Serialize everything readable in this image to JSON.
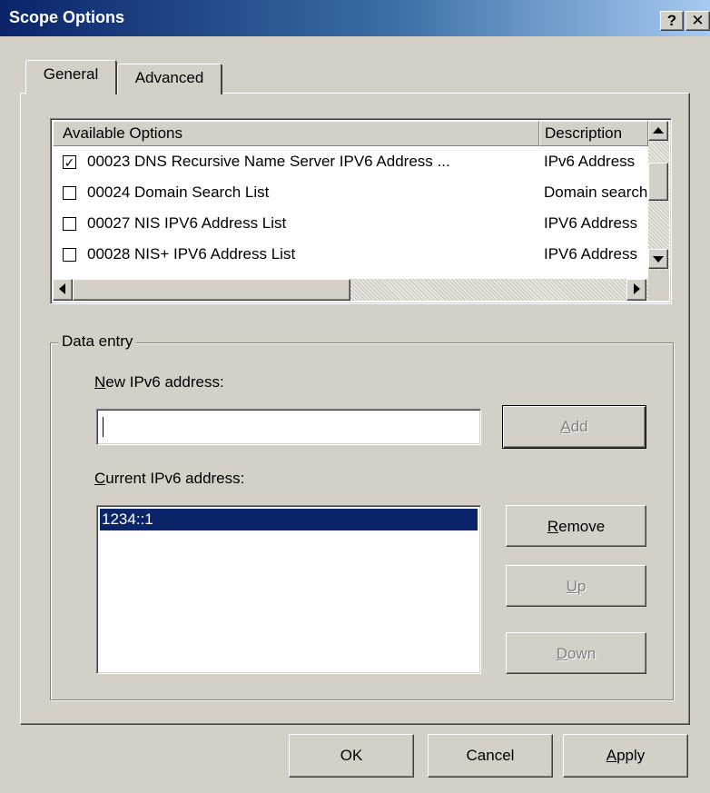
{
  "window": {
    "title": "Scope Options",
    "help_glyph": "?",
    "close_glyph": "✕"
  },
  "tabs": [
    {
      "label": "General",
      "selected": true
    },
    {
      "label": "Advanced",
      "selected": false
    }
  ],
  "options_list": {
    "columns": [
      "Available Options",
      "Description"
    ],
    "rows": [
      {
        "checked": true,
        "name": "00023 DNS Recursive Name Server IPV6 Address ...",
        "description": "IPv6 Address"
      },
      {
        "checked": false,
        "name": "00024 Domain Search List",
        "description": "Domain search"
      },
      {
        "checked": false,
        "name": "00027 NIS IPV6 Address List",
        "description": "IPV6 Address"
      },
      {
        "checked": false,
        "name": "00028 NIS+ IPV6 Address List",
        "description": "IPV6 Address"
      }
    ]
  },
  "data_entry": {
    "group_label": "Data entry",
    "new_label_accel": "N",
    "new_label_rest": "ew IPv6 address:",
    "new_value": "",
    "add_accel": "A",
    "add_rest": "dd",
    "current_label_accel": "C",
    "current_label_rest": "urrent IPv6 address:",
    "addresses": [
      "1234::1"
    ],
    "remove_accel": "R",
    "remove_rest": "emove",
    "up_accel": "U",
    "up_rest": "p",
    "down_accel": "D",
    "down_rest": "own"
  },
  "footer": {
    "ok": "OK",
    "cancel": "Cancel",
    "apply_accel": "A",
    "apply_rest": "pply"
  },
  "colors": {
    "title_start": "#0a246a",
    "title_end": "#a6caf0",
    "selection": "#0a246a",
    "face": "#d4d0c8"
  }
}
